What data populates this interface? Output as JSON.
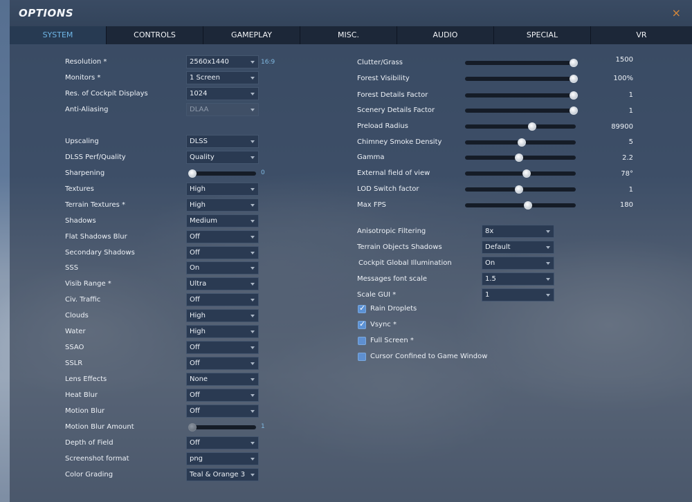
{
  "window": {
    "title": "OPTIONS",
    "close_icon": "×"
  },
  "tabs": [
    "SYSTEM",
    "CONTROLS",
    "GAMEPLAY",
    "MISC.",
    "AUDIO",
    "SPECIAL",
    "VR"
  ],
  "left": {
    "resolution": {
      "label": "Resolution *",
      "value": "2560x1440",
      "aspect": "16:9"
    },
    "monitors": {
      "label": "Monitors *",
      "value": "1 Screen"
    },
    "cockpit_res": {
      "label": "Res. of Cockpit Displays",
      "value": "1024"
    },
    "anti_aliasing": {
      "label": "Anti-Aliasing",
      "value": "DLAA"
    },
    "upscaling": {
      "label": "Upscaling",
      "value": "DLSS"
    },
    "dlss_quality": {
      "label": "DLSS Perf/Quality",
      "value": "Quality"
    },
    "sharpening": {
      "label": "Sharpening",
      "value": "0",
      "fraction": 0.0
    },
    "textures": {
      "label": "Textures",
      "value": "High"
    },
    "terrain_textures": {
      "label": "Terrain Textures *",
      "value": "High"
    },
    "shadows": {
      "label": "Shadows",
      "value": "Medium"
    },
    "flat_shadows_blur": {
      "label": "Flat Shadows Blur",
      "value": "Off"
    },
    "secondary_shadows": {
      "label": "Secondary Shadows",
      "value": "Off"
    },
    "sss": {
      "label": "SSS",
      "value": "On"
    },
    "visib_range": {
      "label": "Visib Range *",
      "value": "Ultra"
    },
    "civ_traffic": {
      "label": "Civ. Traffic",
      "value": "Off"
    },
    "clouds": {
      "label": "Clouds",
      "value": "High"
    },
    "water": {
      "label": "Water",
      "value": "High"
    },
    "ssao": {
      "label": "SSAO",
      "value": "Off"
    },
    "sslr": {
      "label": "SSLR",
      "value": "Off"
    },
    "lens_effects": {
      "label": "Lens Effects",
      "value": "None"
    },
    "heat_blur": {
      "label": "Heat Blur",
      "value": "Off"
    },
    "motion_blur": {
      "label": "Motion Blur",
      "value": "Off"
    },
    "motion_blur_amount": {
      "label": "Motion Blur Amount",
      "value": "1",
      "fraction": 0.0
    },
    "depth_of_field": {
      "label": "Depth of Field",
      "value": "Off"
    },
    "screenshot_format": {
      "label": "Screenshot format",
      "value": "png"
    },
    "color_grading": {
      "label": "Color Grading",
      "value": "Teal & Orange 3"
    }
  },
  "right": {
    "clutter_grass": {
      "label": "Clutter/Grass",
      "value": "1500",
      "fraction": 1.0
    },
    "forest_visibility": {
      "label": "Forest Visibility",
      "value": "100%",
      "fraction": 1.0
    },
    "forest_details": {
      "label": "Forest Details Factor",
      "value": "1",
      "fraction": 1.0
    },
    "scenery_details": {
      "label": "Scenery Details Factor",
      "value": "1",
      "fraction": 1.0
    },
    "preload_radius": {
      "label": "Preload Radius",
      "value": "89900",
      "fraction": 0.6
    },
    "chimney_smoke": {
      "label": "Chimney Smoke Density",
      "value": "5",
      "fraction": 0.5
    },
    "gamma": {
      "label": "Gamma",
      "value": "2.2",
      "fraction": 0.48
    },
    "external_fov": {
      "label": "External field of view",
      "value": "78°",
      "fraction": 0.55
    },
    "lod_switch": {
      "label": "LOD Switch factor",
      "value": "1",
      "fraction": 0.48
    },
    "max_fps": {
      "label": "Max FPS",
      "value": "180",
      "fraction": 0.56
    },
    "anisotropic": {
      "label": "Anisotropic Filtering",
      "value": "8x"
    },
    "terrain_objects_shadows": {
      "label": "Terrain Objects Shadows",
      "value": "Default"
    },
    "cockpit_gi": {
      "label": "Cockpit Global Illumination",
      "value": "On"
    },
    "messages_font_scale": {
      "label": "Messages font scale",
      "value": "1.5"
    },
    "scale_gui": {
      "label": "Scale GUI *",
      "value": "1"
    },
    "rain_droplets": {
      "label": "Rain Droplets",
      "checked": true
    },
    "vsync": {
      "label": "Vsync *",
      "checked": true
    },
    "full_screen": {
      "label": "Full Screen *",
      "checked": false
    },
    "cursor_confined": {
      "label": "Cursor Confined to Game Window",
      "checked": false
    }
  },
  "colors": {
    "accent": "#6fb6e6",
    "close": "#d8893a",
    "checkbox": "#5b91d4"
  }
}
